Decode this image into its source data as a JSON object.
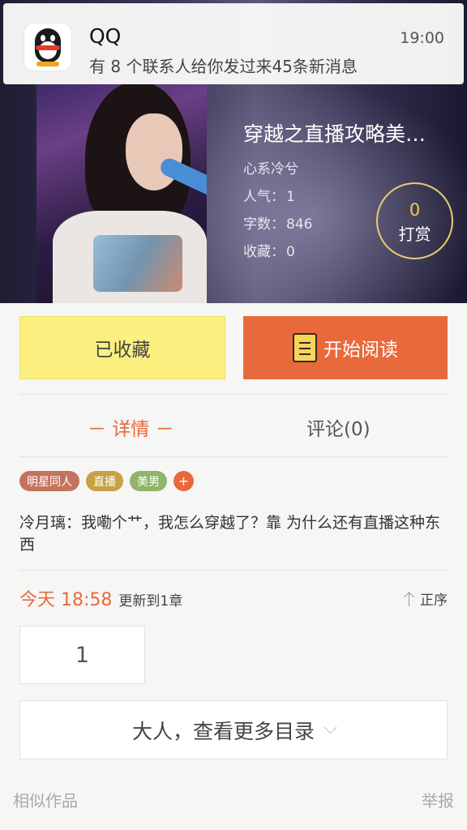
{
  "notification": {
    "app": "QQ",
    "time": "19:00",
    "message": "有 8 个联系人给你发过来45条新消息"
  },
  "book": {
    "title": "穿越之直播攻略美…",
    "author": "心系冷兮",
    "stats": [
      {
        "label": "人气：",
        "value": "1"
      },
      {
        "label": "字数：",
        "value": "846"
      },
      {
        "label": "收藏：",
        "value": "0"
      }
    ],
    "reward": {
      "count": "0",
      "label": "打赏"
    }
  },
  "actions": {
    "favorite_label": "已收藏",
    "read_label": "开始阅读"
  },
  "tabs": [
    {
      "label": "－ 详情 －",
      "active": true
    },
    {
      "label": "评论(0)",
      "active": false
    }
  ],
  "tags": [
    {
      "label": "明星同人",
      "color": "#c5735e"
    },
    {
      "label": "直播",
      "color": "#c9a043"
    },
    {
      "label": "美男",
      "color": "#8fb46a"
    },
    {
      "label": "+",
      "color": "#e8693b"
    }
  ],
  "description": "冷月璃：我嘞个艹，我怎么穿越了？靠 为什么还有直播这种东西",
  "update": {
    "time": "今天 18:58",
    "text": "更新到1章",
    "order_label": "正序"
  },
  "chapter_number": "1",
  "more_catalog_label": "大人，查看更多目录",
  "footer": {
    "similar_label": "相似作品",
    "report_label": "举报"
  },
  "colors": {
    "accent": "#e8693b",
    "favorite_bg": "#fbf07f",
    "reward_ring": "#e7cc74"
  }
}
